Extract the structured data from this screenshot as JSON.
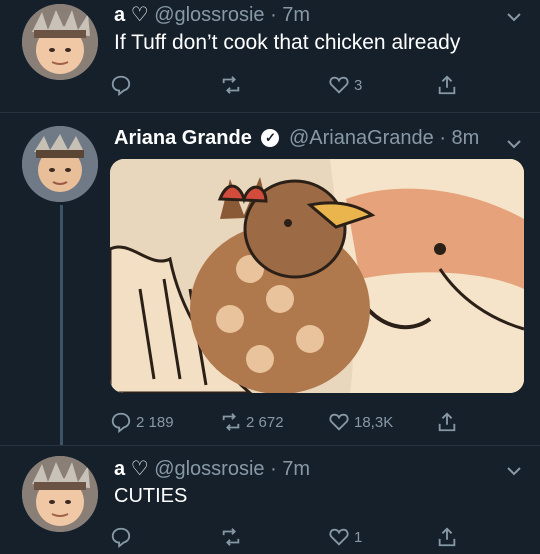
{
  "tweets": [
    {
      "name": "a",
      "heart": "♡",
      "handle": "@glossrosie",
      "time": "· 7m",
      "text": "If  Tuff   don’t cook that chicken already",
      "stats": {
        "replies": "",
        "retweets": "",
        "likes": "3",
        "share": ""
      }
    },
    {
      "name": "Ariana Grande",
      "handle": "@ArianaGrande",
      "time": "· 8m",
      "stats": {
        "replies": "2 189",
        "retweets": "2 672",
        "likes": "18,3K",
        "share": ""
      }
    },
    {
      "name": "a",
      "heart": "♡",
      "handle": "@glossrosie",
      "time": "· 7m",
      "text": "CUTIES",
      "stats": {
        "replies": "",
        "retweets": "",
        "likes": "1",
        "share": ""
      }
    }
  ],
  "icons": {
    "reply": "reply-icon",
    "retweet": "retweet-icon",
    "like": "heart-icon",
    "share": "share-icon",
    "more": "chevron-down-icon",
    "verified": "verified-badge-icon"
  },
  "colors": {
    "background": "#15202b",
    "secondary_text": "#8899a6",
    "separator": "#253341"
  }
}
